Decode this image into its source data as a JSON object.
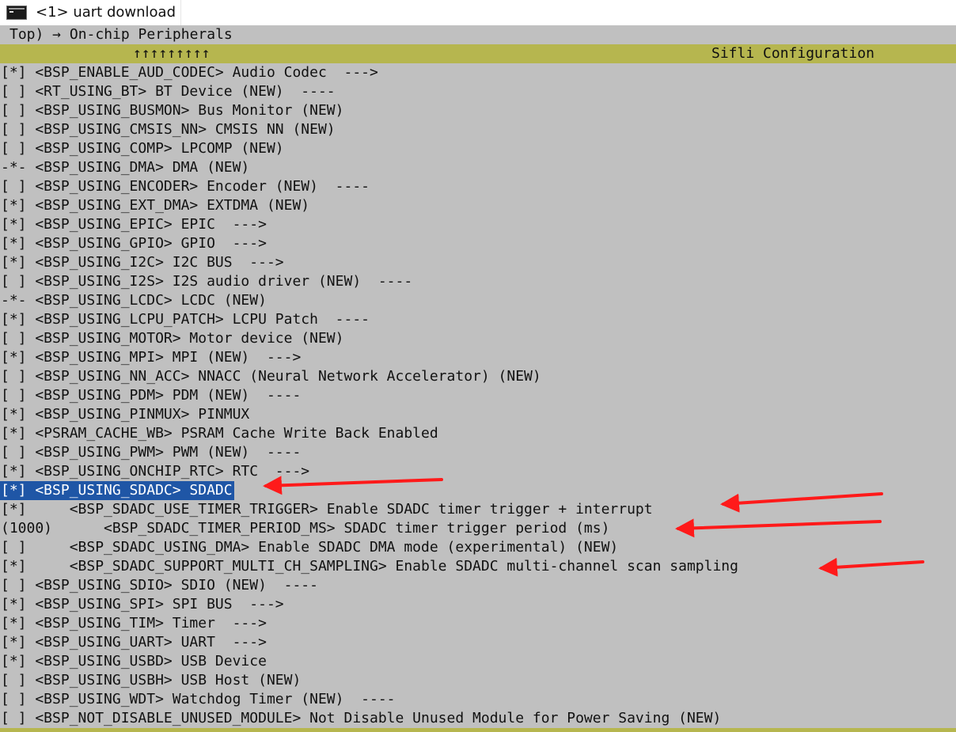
{
  "window": {
    "tab_title": "<1> uart download",
    "tab_icon": "terminal-icon"
  },
  "breadcrumb": "Top) → On-chip Peripherals",
  "header": {
    "arrows": "↑↑↑↑↑↑↑↑↑",
    "title": "Sifli Configuration"
  },
  "colors": {
    "terminal_bg": "#c0c0c0",
    "header_bar": "#b6b64f",
    "selection": "#1f56a6",
    "annotation_arrow": "#ff1a1a"
  },
  "menu": {
    "items": [
      "[*] <BSP_ENABLE_AUD_CODEC> Audio Codec  --->",
      "[ ] <RT_USING_BT> BT Device (NEW)  ----",
      "[ ] <BSP_USING_BUSMON> Bus Monitor (NEW)",
      "[ ] <BSP_USING_CMSIS_NN> CMSIS NN (NEW)",
      "[ ] <BSP_USING_COMP> LPCOMP (NEW)",
      "-*- <BSP_USING_DMA> DMA (NEW)",
      "[ ] <BSP_USING_ENCODER> Encoder (NEW)  ----",
      "[*] <BSP_USING_EXT_DMA> EXTDMA (NEW)",
      "[*] <BSP_USING_EPIC> EPIC  --->",
      "[*] <BSP_USING_GPIO> GPIO  --->",
      "[*] <BSP_USING_I2C> I2C BUS  --->",
      "[ ] <BSP_USING_I2S> I2S audio driver (NEW)  ----",
      "-*- <BSP_USING_LCDC> LCDC (NEW)",
      "[*] <BSP_USING_LCPU_PATCH> LCPU Patch  ----",
      "[ ] <BSP_USING_MOTOR> Motor device (NEW)",
      "[*] <BSP_USING_MPI> MPI (NEW)  --->",
      "[ ] <BSP_USING_NN_ACC> NNACC (Neural Network Accelerator) (NEW)",
      "[ ] <BSP_USING_PDM> PDM (NEW)  ----",
      "[*] <BSP_USING_PINMUX> PINMUX",
      "[*] <PSRAM_CACHE_WB> PSRAM Cache Write Back Enabled",
      "[ ] <BSP_USING_PWM> PWM (NEW)  ----",
      "[*] <BSP_USING_ONCHIP_RTC> RTC  --->",
      "[*] <BSP_USING_SDADC> SDADC",
      "[*]     <BSP_SDADC_USE_TIMER_TRIGGER> Enable SDADC timer trigger + interrupt",
      "(1000)      <BSP_SDADC_TIMER_PERIOD_MS> SDADC timer trigger period (ms)",
      "[ ]     <BSP_SDADC_USING_DMA> Enable SDADC DMA mode (experimental) (NEW)",
      "[*]     <BSP_SDADC_SUPPORT_MULTI_CH_SAMPLING> Enable SDADC multi-channel scan sampling",
      "[ ] <BSP_USING_SDIO> SDIO (NEW)  ----",
      "[*] <BSP_USING_SPI> SPI BUS  --->",
      "[*] <BSP_USING_TIM> Timer  --->",
      "[*] <BSP_USING_UART> UART  --->",
      "[*] <BSP_USING_USBD> USB Device",
      "[ ] <BSP_USING_USBH> USB Host (NEW)",
      "[ ] <BSP_USING_WDT> Watchdog Timer (NEW)  ----",
      "[ ] <BSP_NOT_DISABLE_UNUSED_MODULE> Not Disable Unused Module for Power Saving (NEW)"
    ],
    "selected_index": 22
  }
}
